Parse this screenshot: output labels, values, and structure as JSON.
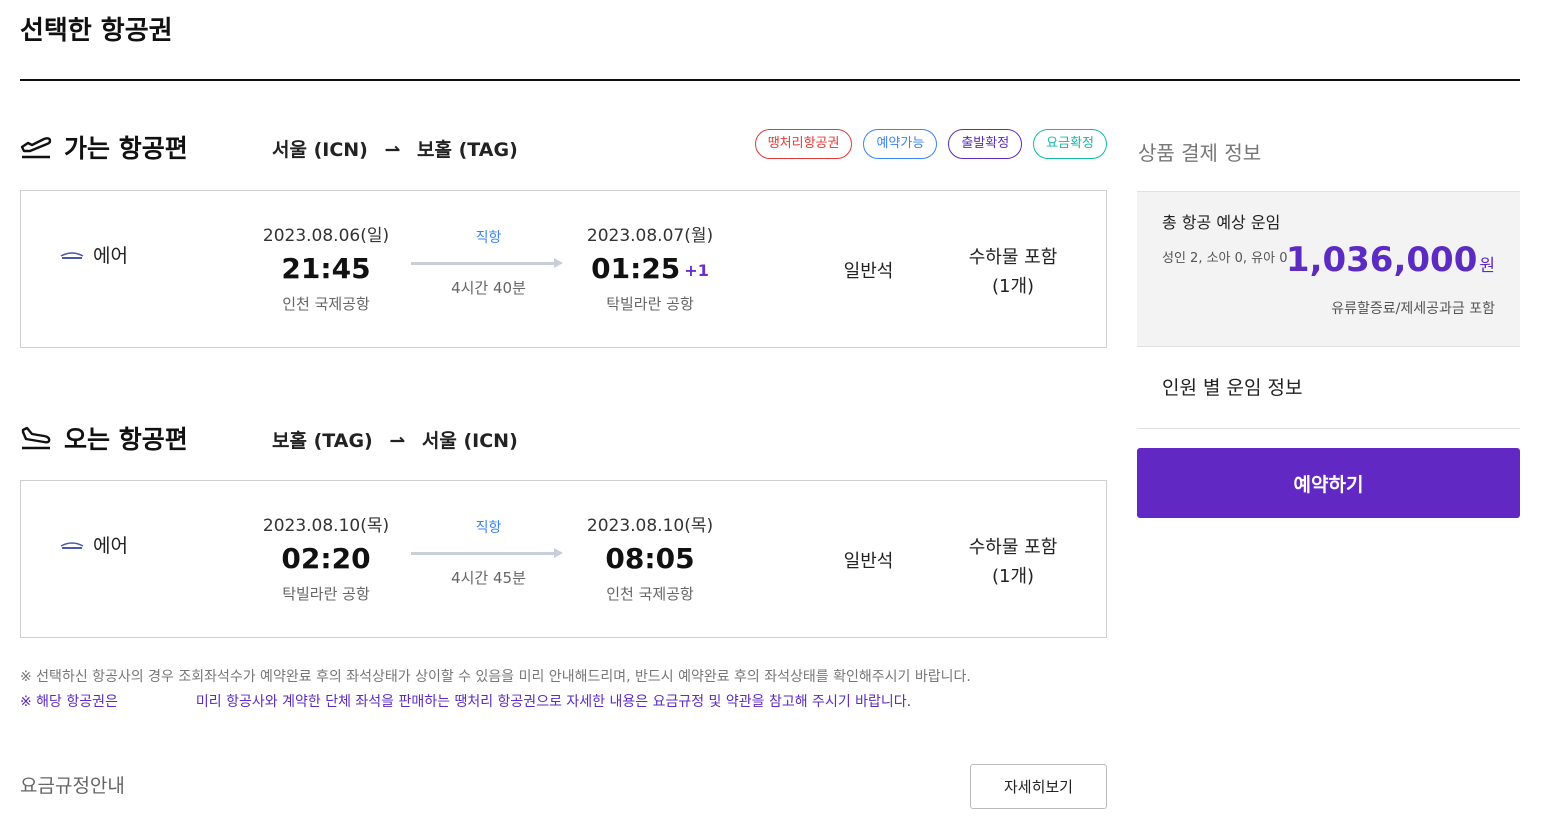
{
  "page": {
    "title": "선택한 항공권"
  },
  "outbound": {
    "section_title": "가는 항공편",
    "route": {
      "from": "서울 (ICN)",
      "arrow": "⇀",
      "to": "보홀 (TAG)"
    },
    "badges": [
      {
        "label": "땡처리항공권",
        "color": "#e53935"
      },
      {
        "label": "예약가능",
        "color": "#3b82f6"
      },
      {
        "label": "출발확정",
        "color": "#5b2bc2"
      },
      {
        "label": "요금확정",
        "color": "#14b8a6"
      }
    ],
    "airline": "에어",
    "departure": {
      "date": "2023.08.06(일)",
      "time": "21:45",
      "airport": "인천 국제공항"
    },
    "flight": {
      "type": "직항",
      "duration": "4시간 40분"
    },
    "arrival": {
      "date": "2023.08.07(월)",
      "time": "01:25",
      "plus_day": "+1",
      "airport": "탁빌라란 공항"
    },
    "seat_class": "일반석",
    "baggage": {
      "line1": "수하물 포함",
      "line2": "(1개)"
    }
  },
  "inbound": {
    "section_title": "오는 항공편",
    "route": {
      "from": "보홀 (TAG)",
      "arrow": "⇀",
      "to": "서울 (ICN)"
    },
    "airline": "에어",
    "departure": {
      "date": "2023.08.10(목)",
      "time": "02:20",
      "airport": "탁빌라란 공항"
    },
    "flight": {
      "type": "직항",
      "duration": "4시간 45분"
    },
    "arrival": {
      "date": "2023.08.10(목)",
      "time": "08:05",
      "airport": "인천 국제공항"
    },
    "seat_class": "일반석",
    "baggage": {
      "line1": "수하물 포함",
      "line2": "(1개)"
    }
  },
  "notices": {
    "line1": "※ 선택하신 항공사의 경우 조회좌석수가 예약완료 후의 좌석상태가 상이할 수 있음을 미리 안내해드리며, 반드시 예약완료 후의 좌석상태를 확인해주시기 바랍니다.",
    "line2_start": "※ 해당 항공권은",
    "line2_end": "미리 항공사와 계약한 단체 좌석을 판매하는 땡처리 항공권으로 자세한 내용은 요금규정 및 약관을 참고해 주시기 바랍니다."
  },
  "fare_rules": {
    "title": "요금규정안내",
    "detail_button": "자세히보기"
  },
  "payment": {
    "title": "상품 결제 정보",
    "total_label": "총 항공 예상 운임",
    "passengers": "성인 2, 소아 0, 유아 0",
    "total_amount": "1,036,000",
    "currency_unit": "원",
    "includes": "유류할증료/제세공과금 포함",
    "per_person_label": "인원 별 운임 정보",
    "book_button": "예약하기"
  }
}
